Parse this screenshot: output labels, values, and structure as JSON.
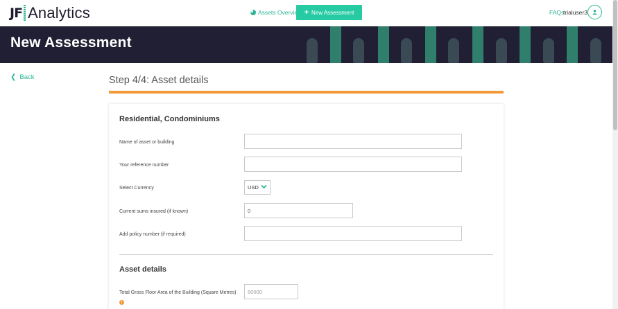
{
  "brand": {
    "initials": "JF",
    "name": "Analytics"
  },
  "nav": {
    "assets_overview": "Assets Overview",
    "new_assessment": "New Assessment",
    "faqs": "FAQs",
    "username": "trialuser3"
  },
  "banner": {
    "title": "New Assessment"
  },
  "back_label": "Back",
  "step": {
    "title": "Step 4/4: Asset details",
    "progress_fraction": 1.0
  },
  "form": {
    "section_residential": "Residential, Condominiums",
    "fields": {
      "asset_name": {
        "label": "Name of asset or building",
        "value": ""
      },
      "reference": {
        "label": "Your reference number",
        "value": ""
      },
      "currency": {
        "label": "Select Currency",
        "value": "USD"
      },
      "sums_insured": {
        "label": "Current sums insured (if known)",
        "value": "0"
      },
      "policy_number": {
        "label": "Add policy number (if required)",
        "value": ""
      }
    },
    "section_asset_details": "Asset details",
    "gross_floor_area": {
      "label": "Total Gross Floor Area of the Building (Square Metres)",
      "placeholder": "50000"
    },
    "info_glyph": "!"
  },
  "colors": {
    "accent": "#27cba3",
    "banner_bg": "#201f33",
    "progress": "#f2993a"
  }
}
